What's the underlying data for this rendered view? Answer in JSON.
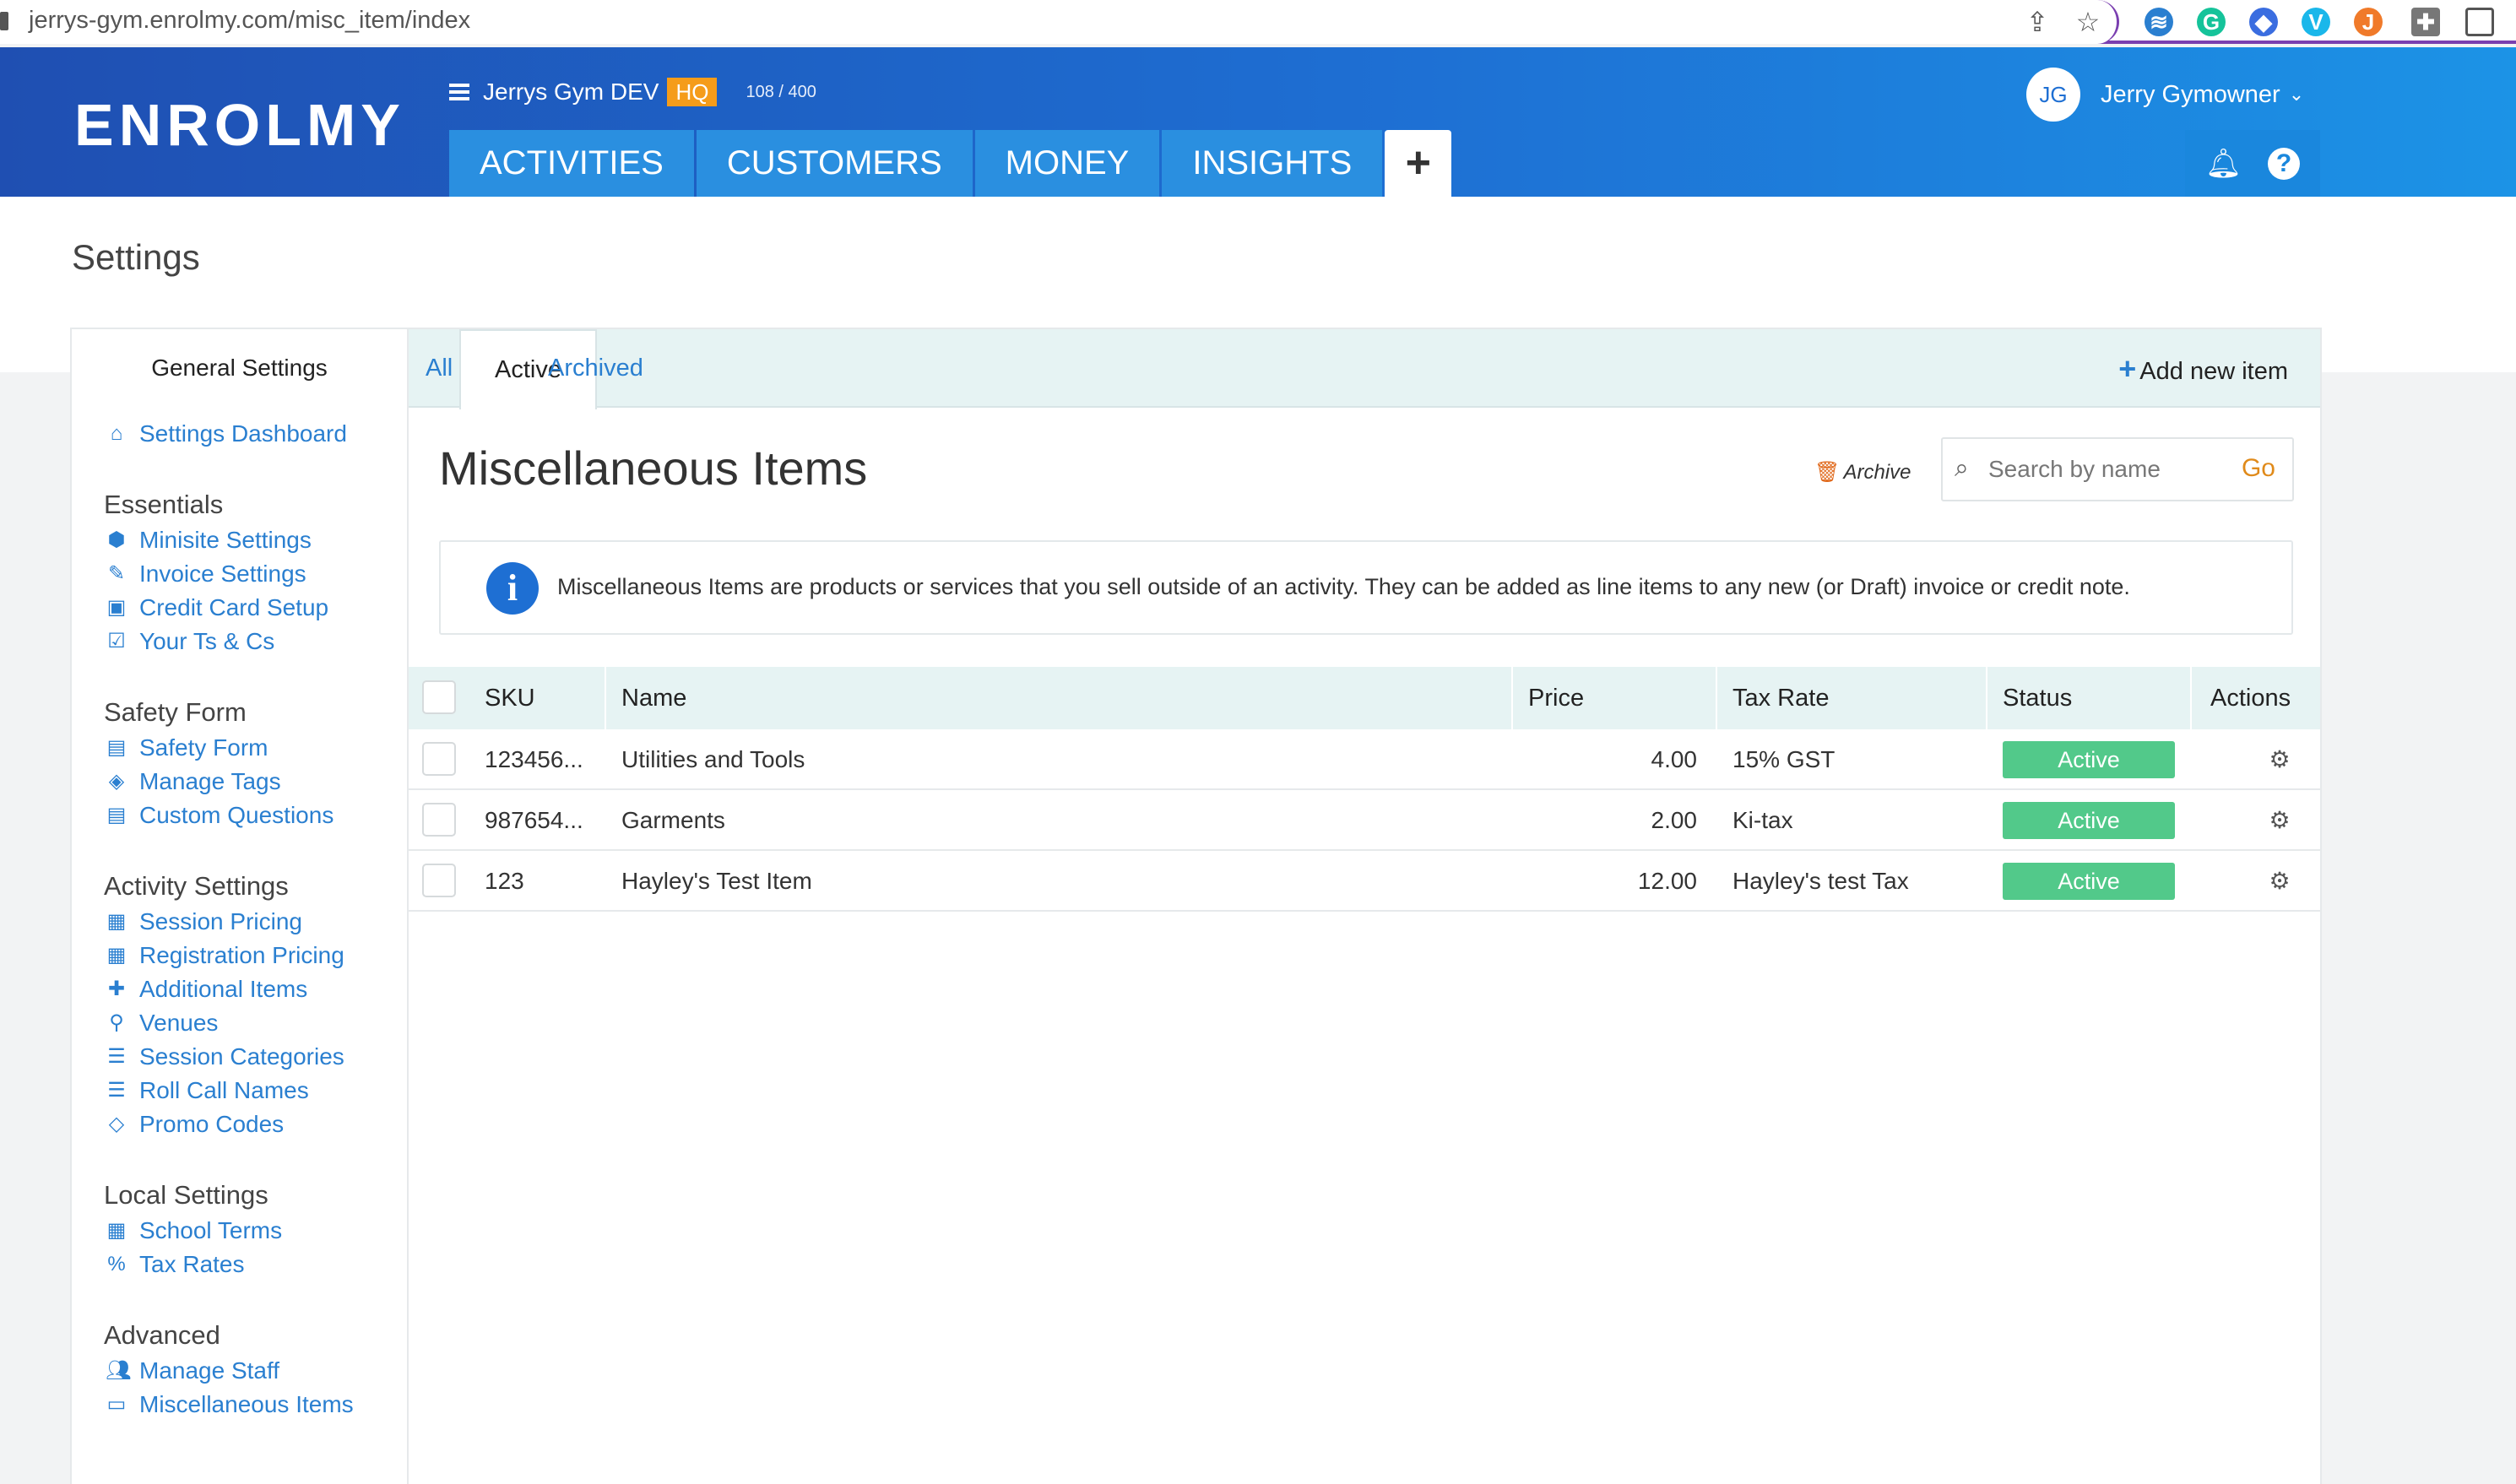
{
  "browser": {
    "url_host": "jerrys-gym.enrolmy.com",
    "url_path": "/misc_item/index"
  },
  "header": {
    "logo": "ENROLMY",
    "org_name": "Jerrys Gym DEV",
    "org_badge": "HQ",
    "counter": "108 / 400",
    "nav": [
      "ACTIVITIES",
      "CUSTOMERS",
      "MONEY",
      "INSIGHTS"
    ],
    "plus": "+",
    "user_initials": "JG",
    "user_name": "Jerry Gymowner"
  },
  "page": {
    "title": "Settings"
  },
  "sidebar": {
    "title": "General Settings",
    "dashboard": "Settings Dashboard",
    "groups": [
      {
        "title": "Essentials",
        "items": [
          {
            "label": "Minisite Settings",
            "icon": "cube-icon"
          },
          {
            "label": "Invoice Settings",
            "icon": "pencil-icon"
          },
          {
            "label": "Credit Card Setup",
            "icon": "money-icon"
          },
          {
            "label": "Your Ts & Cs",
            "icon": "check-square-icon"
          }
        ]
      },
      {
        "title": "Safety Form",
        "items": [
          {
            "label": "Safety Form",
            "icon": "file-icon"
          },
          {
            "label": "Manage Tags",
            "icon": "tags-icon"
          },
          {
            "label": "Custom Questions",
            "icon": "file-icon"
          }
        ]
      },
      {
        "title": "Activity Settings",
        "items": [
          {
            "label": "Session Pricing",
            "icon": "briefcase-icon"
          },
          {
            "label": "Registration Pricing",
            "icon": "briefcase-icon"
          },
          {
            "label": "Additional Items",
            "icon": "puzzle-icon"
          },
          {
            "label": "Venues",
            "icon": "map-marker-icon"
          },
          {
            "label": "Session Categories",
            "icon": "list-icon"
          },
          {
            "label": "Roll Call Names",
            "icon": "list-icon"
          },
          {
            "label": "Promo Codes",
            "icon": "ticket-icon"
          }
        ]
      },
      {
        "title": "Local Settings",
        "items": [
          {
            "label": "School Terms",
            "icon": "calendar-icon"
          },
          {
            "label": "Tax Rates",
            "icon": "percent-icon"
          }
        ]
      },
      {
        "title": "Advanced",
        "items": [
          {
            "label": "Manage Staff",
            "icon": "users-icon"
          },
          {
            "label": "Miscellaneous Items",
            "icon": "archive-icon"
          }
        ]
      }
    ]
  },
  "main": {
    "tabs": [
      "All",
      "Active",
      "Archived"
    ],
    "active_tab": "Active",
    "add_new": "Add new item",
    "title": "Miscellaneous Items",
    "archive_button": "Archive",
    "search_placeholder": "Search by name",
    "go": "Go",
    "info": "Miscellaneous Items are products or services that you sell outside of an activity. They can be added as line items to any new (or Draft) invoice or credit note.",
    "columns": [
      "SKU",
      "Name",
      "Price",
      "Tax Rate",
      "Status",
      "Actions"
    ],
    "rows": [
      {
        "sku": "123456...",
        "name": "Utilities and Tools",
        "price": "4.00",
        "tax": "15% GST",
        "status": "Active"
      },
      {
        "sku": "987654...",
        "name": "Garments",
        "price": "2.00",
        "tax": "Ki-tax",
        "status": "Active"
      },
      {
        "sku": "123",
        "name": "Hayley's Test Item",
        "price": "12.00",
        "tax": "Hayley's test Tax",
        "status": "Active"
      }
    ]
  }
}
